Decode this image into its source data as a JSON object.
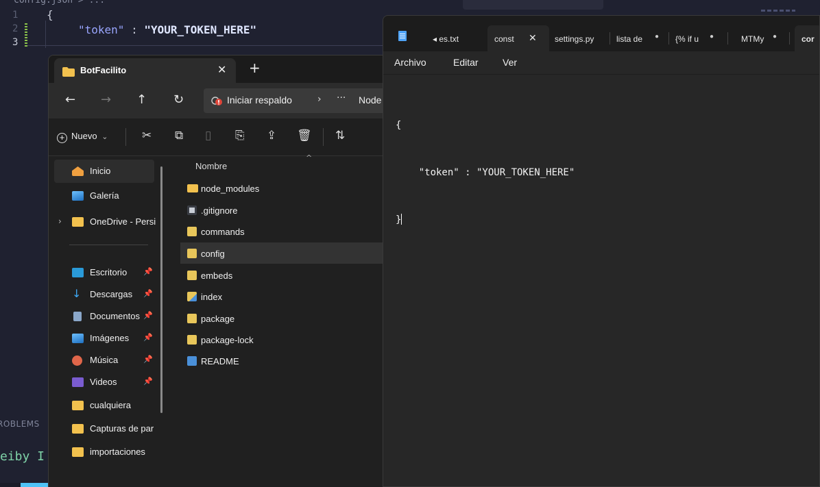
{
  "vscode": {
    "breadcrumb": "config.json > ...",
    "line_numbers": [
      "1",
      "2",
      "3"
    ],
    "code": {
      "open_brace": "{",
      "key": "\"token\"",
      "colon": " : ",
      "value": "\"YOUR_TOKEN_HERE\"",
      "close_brace": "}"
    },
    "panel_tab": "ROBLEMS",
    "terminal_text": "eiby I"
  },
  "explorer": {
    "tab_title": "BotFacilito",
    "tab_close": "✕",
    "new_tab": "+",
    "nav": {
      "back": "←",
      "forward": "→",
      "up": "↑",
      "refresh": "↻"
    },
    "address": {
      "root": "Iniciar respaldo",
      "separator": "›",
      "more": "···",
      "current": "Node"
    },
    "toolbar": {
      "new_label": "Nuevo",
      "new_chevron": "⌄"
    },
    "sidebar": {
      "quick": [
        {
          "label": "Inicio",
          "color": "#f0a040"
        },
        {
          "label": "Galería",
          "color": "#3a8fd8"
        },
        {
          "label": "OneDrive - Persi",
          "color": "#f2c14e"
        }
      ],
      "pinned": [
        {
          "label": "Escritorio",
          "color": "#2a9ad8"
        },
        {
          "label": "Descargas",
          "color": "#3fa9f5"
        },
        {
          "label": "Documentos",
          "color": "#8aa7c9"
        },
        {
          "label": "Imágenes",
          "color": "#3a8fd8"
        },
        {
          "label": "Música",
          "color": "#e0664a"
        },
        {
          "label": "Videos",
          "color": "#7a5cd0"
        },
        {
          "label": "cualquiera",
          "color": "#f2c14e"
        },
        {
          "label": "Capturas de par",
          "color": "#f2c14e"
        },
        {
          "label": "importaciones",
          "color": "#f2c14e"
        }
      ]
    },
    "files": {
      "column_name": "Nombre",
      "sort_indicator": "^",
      "items": [
        {
          "name": "node_modules",
          "type": "folder",
          "color": "#f2c14e"
        },
        {
          "name": ".gitignore",
          "type": "file",
          "color": "#9aa0aa"
        },
        {
          "name": "commands",
          "type": "json",
          "color": "#e8c65a"
        },
        {
          "name": "config",
          "type": "json",
          "color": "#e8c65a"
        },
        {
          "name": "embeds",
          "type": "json",
          "color": "#e8c65a"
        },
        {
          "name": "index",
          "type": "js",
          "color": "#e8c65a"
        },
        {
          "name": "package",
          "type": "json",
          "color": "#e8c65a"
        },
        {
          "name": "package-lock",
          "type": "json",
          "color": "#e8c65a"
        },
        {
          "name": "README",
          "type": "md",
          "color": "#4a90d9"
        }
      ],
      "selected": "config"
    }
  },
  "notepad": {
    "tabs": [
      {
        "label": "◂  es.txt",
        "state": "normal"
      },
      {
        "label": "const",
        "state": "active",
        "close": "✕"
      },
      {
        "label": "settings.py",
        "state": "normal"
      },
      {
        "label": "lista de",
        "state": "modified"
      },
      {
        "label": "{% if u",
        "state": "modified"
      },
      {
        "label": "MTMy",
        "state": "modified"
      },
      {
        "label": "cor",
        "state": "normal"
      }
    ],
    "menu": [
      "Archivo",
      "Editar",
      "Ver"
    ],
    "content": {
      "line1": "{",
      "line2": "    \"token\" : \"YOUR_TOKEN_HERE\"",
      "line3": "}"
    }
  }
}
